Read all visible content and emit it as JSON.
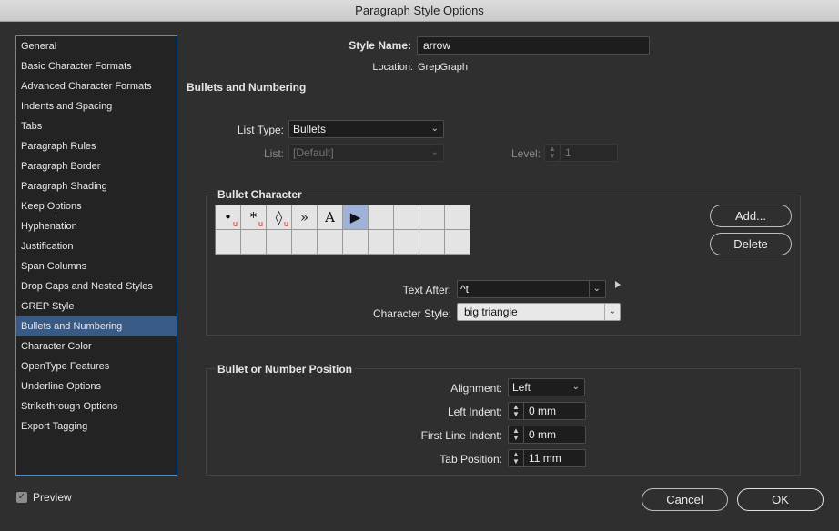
{
  "window": {
    "title": "Paragraph Style Options"
  },
  "sidebar": {
    "items": [
      {
        "label": "General"
      },
      {
        "label": "Basic Character Formats"
      },
      {
        "label": "Advanced Character Formats"
      },
      {
        "label": "Indents and Spacing"
      },
      {
        "label": "Tabs"
      },
      {
        "label": "Paragraph Rules"
      },
      {
        "label": "Paragraph Border"
      },
      {
        "label": "Paragraph Shading"
      },
      {
        "label": "Keep Options"
      },
      {
        "label": "Hyphenation"
      },
      {
        "label": "Justification"
      },
      {
        "label": "Span Columns"
      },
      {
        "label": "Drop Caps and Nested Styles"
      },
      {
        "label": "GREP Style"
      },
      {
        "label": "Bullets and Numbering"
      },
      {
        "label": "Character Color"
      },
      {
        "label": "OpenType Features"
      },
      {
        "label": "Underline Options"
      },
      {
        "label": "Strikethrough Options"
      },
      {
        "label": "Export Tagging"
      }
    ],
    "selected": "Bullets and Numbering"
  },
  "header": {
    "style_name_label": "Style Name:",
    "style_name_value": "arrow",
    "location_label": "Location:",
    "location_value": "GrepGraph",
    "section_title": "Bullets and Numbering"
  },
  "list": {
    "type_label": "List Type:",
    "type_value": "Bullets",
    "list_label": "List:",
    "list_value": "[Default]",
    "level_label": "Level:",
    "level_value": "1"
  },
  "bullet_character": {
    "title": "Bullet Character",
    "glyphs": [
      "•",
      "*",
      "◊",
      "»",
      "A",
      "▶",
      "",
      "",
      "",
      "",
      "",
      "",
      "",
      "",
      "",
      "",
      "",
      "",
      "",
      ""
    ],
    "glyph_markers": [
      "u",
      "u",
      "u",
      "",
      "",
      "",
      "",
      "",
      "",
      "",
      "",
      "",
      "",
      "",
      "",
      "",
      "",
      "",
      "",
      ""
    ],
    "selected_index": 5,
    "add_button": "Add...",
    "delete_button": "Delete",
    "text_after_label": "Text After:",
    "text_after_value": "^t",
    "char_style_label": "Character Style:",
    "char_style_value": "big triangle"
  },
  "position": {
    "title": "Bullet or Number Position",
    "alignment_label": "Alignment:",
    "alignment_value": "Left",
    "left_indent_label": "Left Indent:",
    "left_indent_value": "0 mm",
    "first_line_label": "First Line Indent:",
    "first_line_value": "0 mm",
    "tab_position_label": "Tab Position:",
    "tab_position_value": "11 mm"
  },
  "footer": {
    "preview_label": "Preview",
    "preview_checked": true,
    "cancel_button": "Cancel",
    "ok_button": "OK"
  }
}
